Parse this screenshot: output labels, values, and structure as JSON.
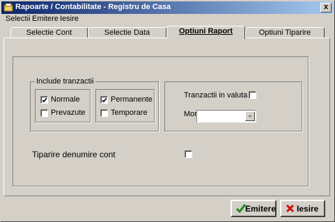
{
  "window": {
    "title": "Rapoarte / Contabilitate  - Registru de Casa",
    "close_glyph": "x"
  },
  "menu": [
    "Selectii",
    "Emitere",
    "Iesire"
  ],
  "tabs": [
    "Selectie Cont",
    "Selectie Data",
    "Optiuni Raport",
    "Optiuni Tiparire"
  ],
  "active_tab": "Optiuni Raport",
  "include_group": {
    "label": "Include tranzactii",
    "items": [
      {
        "label": "Normale",
        "checked": true
      },
      {
        "label": "Prevazute",
        "checked": false
      },
      {
        "label": "Permanente",
        "checked": true
      },
      {
        "label": "Temporare",
        "checked": false
      }
    ]
  },
  "currency_group": {
    "foreign_label": "Tranzactii in valuta",
    "foreign_checked": false,
    "currency_label": "Moneda",
    "currency_value": ""
  },
  "print_name": {
    "label": "Tiparire denumire cont",
    "checked": false
  },
  "buttons": {
    "emit": "Emitere",
    "exit": "Iesire"
  },
  "icons": [
    "app-icon",
    "checkmark-icon",
    "red-x-icon",
    "chevron-down-icon"
  ]
}
